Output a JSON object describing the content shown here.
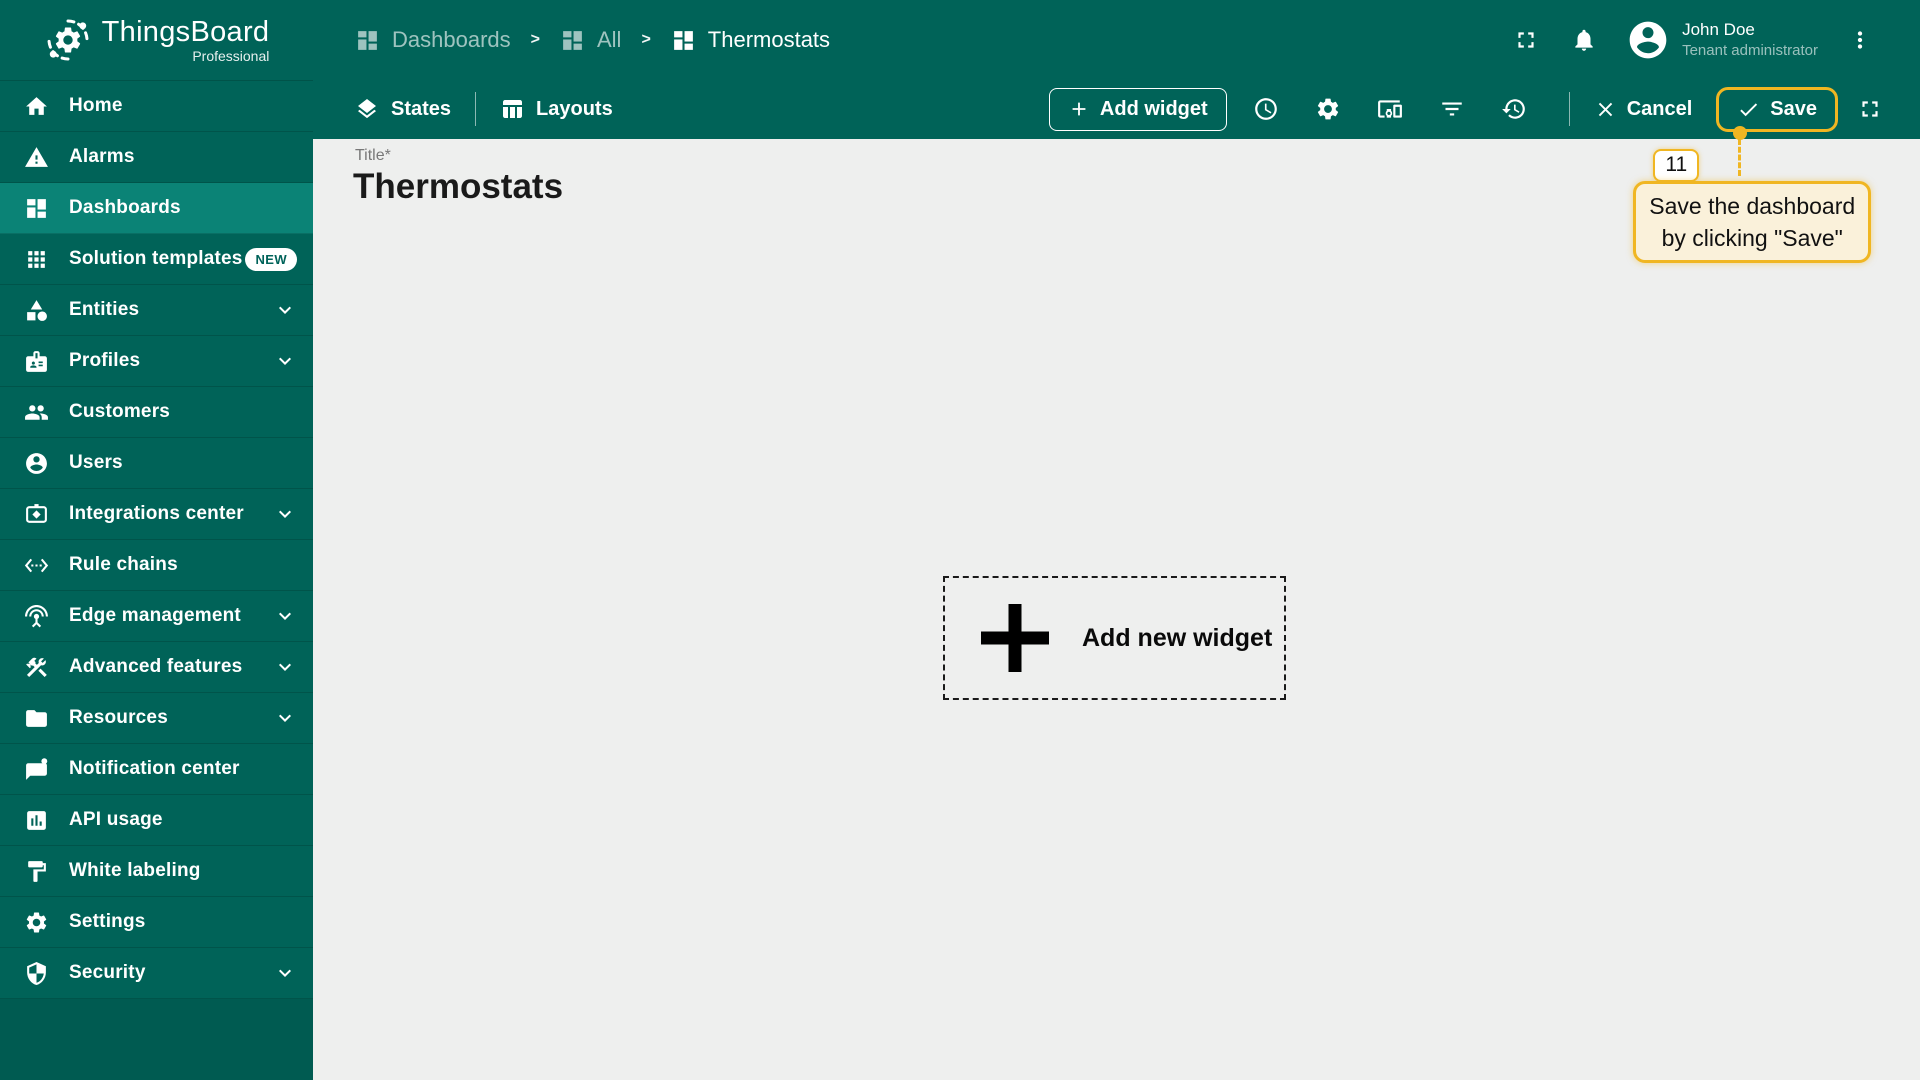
{
  "app": {
    "name": "ThingsBoard",
    "edition": "Professional",
    "logo_icon": "thingsboard-logo"
  },
  "colors": {
    "sidebar_teal": "#006358",
    "active_item_teal": "#0B8376",
    "content_gray": "#EEEFEE",
    "annotation_gold": "#F0B622",
    "tooltip_cream": "#FAF1DA"
  },
  "sidebar": {
    "items": [
      {
        "label": "Home",
        "icon": "home"
      },
      {
        "label": "Alarms",
        "icon": "warning"
      },
      {
        "label": "Dashboards",
        "icon": "dashboard",
        "active": true
      },
      {
        "label": "Solution templates",
        "icon": "apps",
        "badge": "NEW"
      },
      {
        "label": "Entities",
        "icon": "category",
        "expandable": true
      },
      {
        "label": "Profiles",
        "icon": "badge",
        "expandable": true
      },
      {
        "label": "Customers",
        "icon": "people"
      },
      {
        "label": "Users",
        "icon": "account"
      },
      {
        "label": "Integrations center",
        "icon": "integration",
        "expandable": true
      },
      {
        "label": "Rule chains",
        "icon": "ethernet"
      },
      {
        "label": "Edge management",
        "icon": "antenna",
        "expandable": true
      },
      {
        "label": "Advanced features",
        "icon": "construction",
        "expandable": true
      },
      {
        "label": "Resources",
        "icon": "folder",
        "expandable": true
      },
      {
        "label": "Notification center",
        "icon": "notification"
      },
      {
        "label": "API usage",
        "icon": "chart"
      },
      {
        "label": "White labeling",
        "icon": "paint"
      },
      {
        "label": "Settings",
        "icon": "gear"
      },
      {
        "label": "Security",
        "icon": "shield",
        "expandable": true
      }
    ]
  },
  "header": {
    "separator": ">",
    "breadcrumbs": [
      {
        "label": "Dashboards",
        "icon": "dashboard"
      },
      {
        "label": "All",
        "icon": "dashboard"
      },
      {
        "label": "Thermostats",
        "icon": "dashboard",
        "current": true
      }
    ],
    "actions": [
      {
        "name": "fullscreen-button",
        "icon": "fullscreen"
      },
      {
        "name": "notifications-button",
        "icon": "bell"
      }
    ],
    "user": {
      "name": "John Doe",
      "role": "Tenant administrator",
      "avatar_icon": "account"
    },
    "more_icon": "more-vert"
  },
  "toolbar": {
    "states_label": "States",
    "states_icon": "layers",
    "layouts_label": "Layouts",
    "layouts_icon": "table",
    "add_widget_label": "Add widget",
    "add_widget_icon": "plus",
    "icon_buttons": [
      {
        "name": "time-window-button",
        "icon": "schedule"
      },
      {
        "name": "dashboard-settings-button",
        "icon": "gear"
      },
      {
        "name": "entity-aliases-button",
        "icon": "devices"
      },
      {
        "name": "filters-button",
        "icon": "filter"
      },
      {
        "name": "version-history-button",
        "icon": "history"
      }
    ],
    "cancel_label": "Cancel",
    "cancel_icon": "close",
    "save_label": "Save",
    "save_icon": "check",
    "fullscreen_icon": "fullscreen"
  },
  "main": {
    "title_label": "Title*",
    "dashboard_title": "Thermostats",
    "add_new_widget_label": "Add new widget",
    "add_new_widget_icon": "plus"
  },
  "annotation": {
    "step_number": "11",
    "line1": "Save the dashboard",
    "line2": "by clicking \"Save\""
  }
}
